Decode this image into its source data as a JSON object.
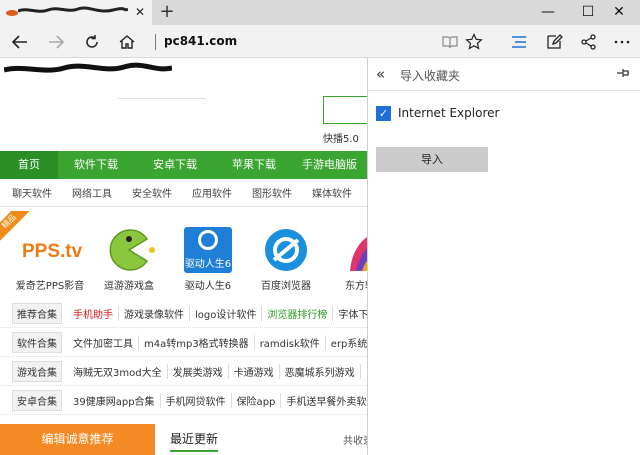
{
  "browser": {
    "tab": {
      "close_glyph": "✕"
    },
    "new_tab_glyph": "+",
    "window_controls": {
      "minimize": "—",
      "maximize": "☐",
      "close": "✕"
    },
    "address": "pc841.com"
  },
  "page": {
    "ad_label": "快播5.0",
    "nav": [
      "首页",
      "软件下载",
      "安卓下载",
      "苹果下载",
      "手游电脑版"
    ],
    "subnav": [
      "聊天软件",
      "网络工具",
      "安全软件",
      "应用软件",
      "图形软件",
      "媒体软件"
    ],
    "badge": "精品",
    "apps": [
      {
        "label": "爱奇艺PPS影音",
        "icon": "pps-logo",
        "logo_text": "PPS.tv"
      },
      {
        "label": "逗游游戏盒",
        "icon": "pacman-icon"
      },
      {
        "label": "驱动人生6",
        "icon": "drivergenius-icon",
        "logo_text": "驱动人生6"
      },
      {
        "label": "百度浏览器",
        "icon": "baidu-browser-icon"
      },
      {
        "label": "东方辅",
        "icon": "fan-icon"
      }
    ],
    "rows": [
      {
        "tag": "推荐合集",
        "links": [
          {
            "text": "手机助手",
            "style": "red"
          },
          {
            "text": "游戏录像软件",
            "style": ""
          },
          {
            "text": "logo设计软件",
            "style": ""
          },
          {
            "text": "浏览器排行榜",
            "style": "green"
          },
          {
            "text": "字体下",
            "style": ""
          }
        ]
      },
      {
        "tag": "软件合集",
        "links": [
          {
            "text": "文件加密工具",
            "style": ""
          },
          {
            "text": "m4a转mp3格式转换器",
            "style": ""
          },
          {
            "text": "ramdisk软件",
            "style": ""
          },
          {
            "text": "erp系统",
            "style": ""
          }
        ]
      },
      {
        "tag": "游戏合集",
        "links": [
          {
            "text": "海贼无双3mod大全",
            "style": ""
          },
          {
            "text": "发展类游戏",
            "style": ""
          },
          {
            "text": "卡通游戏",
            "style": ""
          },
          {
            "text": "恶魔城系列游戏",
            "style": ""
          }
        ]
      },
      {
        "tag": "安卓合集",
        "links": [
          {
            "text": "39健康网app合集",
            "style": ""
          },
          {
            "text": "手机网贷软件",
            "style": ""
          },
          {
            "text": "保险app",
            "style": ""
          },
          {
            "text": "手机送早餐外卖软件",
            "style": ""
          }
        ]
      }
    ],
    "bottom": {
      "orange_tab": "编辑诚意推荐",
      "recent": "最近更新",
      "shared": "共收录"
    }
  },
  "hub": {
    "title": "导入收藏夹",
    "back_glyph": "«",
    "pin_glyph": "⊣",
    "browser_option": "Internet Explorer",
    "browser_option_checked": true,
    "import_button": "导入"
  },
  "colors": {
    "nav_green": "#3aa531",
    "accent_blue": "#1e6fd9",
    "orange": "#f48a23"
  }
}
